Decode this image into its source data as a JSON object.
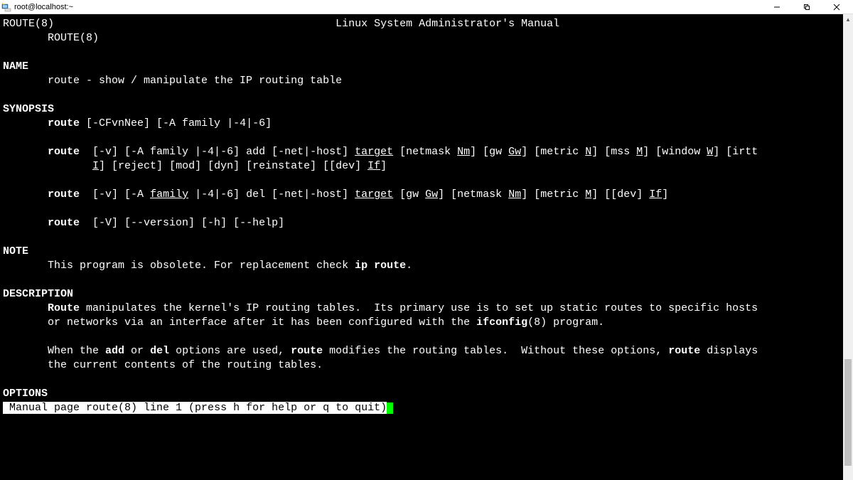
{
  "window": {
    "title": "root@localhost:~"
  },
  "man": {
    "header_left": "ROUTE(8)",
    "header_center": "Linux System Administrator's Manual",
    "header_wrap": "ROUTE(8)",
    "sec_name": "NAME",
    "name_line": "       route - show / manipulate the IP routing table",
    "sec_synopsis": "SYNOPSIS",
    "syn1_pre": "       ",
    "syn1_cmd": "route",
    "syn1_post": " [-CFvnNee] [-A family |-4|-6]",
    "syn2_pre": "       ",
    "syn2_cmd": "route",
    "syn2_a": "  [-v] [-A family |-4|-6] add [-net|-host] ",
    "syn2_target": "target",
    "syn2_b": " [netmask ",
    "syn2_nm": "Nm",
    "syn2_c": "] [gw ",
    "syn2_gw": "Gw",
    "syn2_d": "] [metric ",
    "syn2_n": "N",
    "syn2_e": "] [mss ",
    "syn2_m": "M",
    "syn2_f": "] [window ",
    "syn2_w": "W",
    "syn2_g": "] [irtt",
    "syn2_cont_pad": "              ",
    "syn2_i": "I",
    "syn2_h": "] [reject] [mod] [dyn] [reinstate] [[dev] ",
    "syn2_if": "If",
    "syn2_j": "]",
    "syn3_pre": "       ",
    "syn3_cmd": "route",
    "syn3_a": "  [-v] [-A ",
    "syn3_family": "family",
    "syn3_b": " |-4|-6] del [-net|-host] ",
    "syn3_target": "target",
    "syn3_c": " [gw ",
    "syn3_gw": "Gw",
    "syn3_d": "] [netmask ",
    "syn3_nm": "Nm",
    "syn3_e": "] [metric ",
    "syn3_m": "M",
    "syn3_f": "] [[dev] ",
    "syn3_if": "If",
    "syn3_g": "]",
    "syn4_pre": "       ",
    "syn4_cmd": "route",
    "syn4_post": "  [-V] [--version] [-h] [--help]",
    "sec_note": "NOTE",
    "note_line_a": "       This program is obsolete. For replacement check ",
    "note_ip": "ip route",
    "note_line_b": ".",
    "sec_desc": "DESCRIPTION",
    "desc_route": "Route",
    "desc_l1_a": "       ",
    "desc_l1_b": " manipulates the kernel's IP routing tables.  Its primary use is to set up static routes to specific hosts",
    "desc_l2_a": "       or networks via an interface after it has been configured with the ",
    "desc_ifconfig": "ifconfig",
    "desc_l2_b": "(8) program.",
    "desc_l3_a": "       When the ",
    "desc_add": "add",
    "desc_l3_b": " or ",
    "desc_del": "del",
    "desc_l3_c": " options are used, ",
    "desc_route2": "route",
    "desc_l3_d": " modifies the routing tables.  Without these options, ",
    "desc_route3": "route",
    "desc_l3_e": " displays",
    "desc_l4": "       the current contents of the routing tables.",
    "sec_options": "OPTIONS",
    "status_line": " Manual page route(8) line 1 (press h for help or q to quit)"
  }
}
